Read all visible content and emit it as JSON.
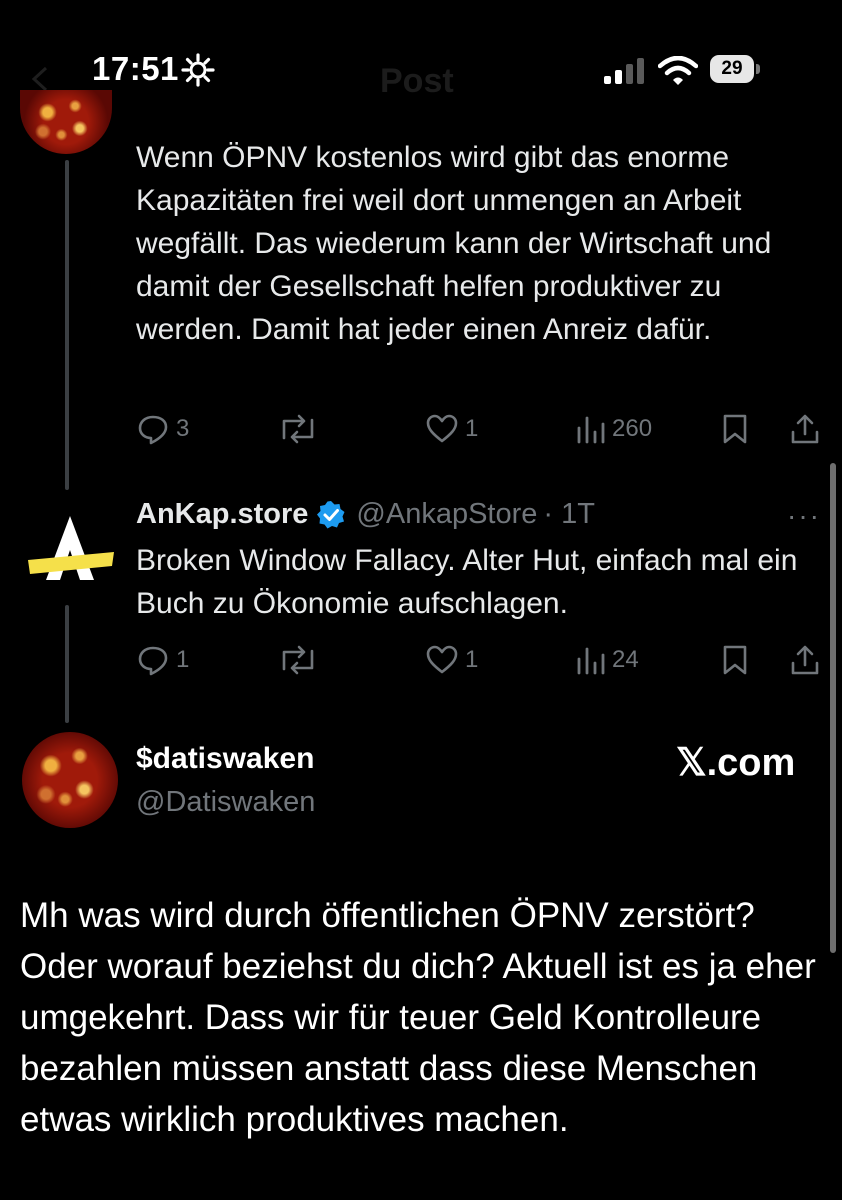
{
  "status_bar": {
    "time": "17:51",
    "battery": "29",
    "header_title": "Post"
  },
  "reply1": {
    "text": "Wenn ÖPNV kostenlos wird gibt das enorme Kapazitäten frei weil dort unmengen an Arbeit wegfällt. Das wiederum kann der Wirtschaft und damit der Gesellschaft helfen produktiver zu werden. Damit hat jeder einen Anreiz dafür.",
    "replies": "3",
    "likes": "1",
    "views": "260"
  },
  "reply2": {
    "author_name": "AnKap.store",
    "author_handle": "@AnkapStore",
    "time": "· 1T",
    "text": "Broken Window Fallacy. Alter Hut, einfach mal ein Buch zu Ökonomie aufschlagen.",
    "replies": "1",
    "likes": "1",
    "views": "24",
    "more": "···"
  },
  "main_post": {
    "author_name": "$datiswaken",
    "author_handle": "@Datiswaken",
    "source": "𝕏.com",
    "text": "Mh was wird durch öffentlichen ÖPNV zerstört? Oder worauf beziehst du dich? Aktuell ist es ja eher umgekehrt. Dass wir für teuer Geld Kontrolleure bezahlen müssen anstatt dass diese Menschen etwas wirklich produktives machen."
  },
  "colors": {
    "background": "#000000",
    "text": "#e7e9ea",
    "muted": "#71767b",
    "verified": "#1d9bf0",
    "logo_yellow": "#f5e04a"
  }
}
